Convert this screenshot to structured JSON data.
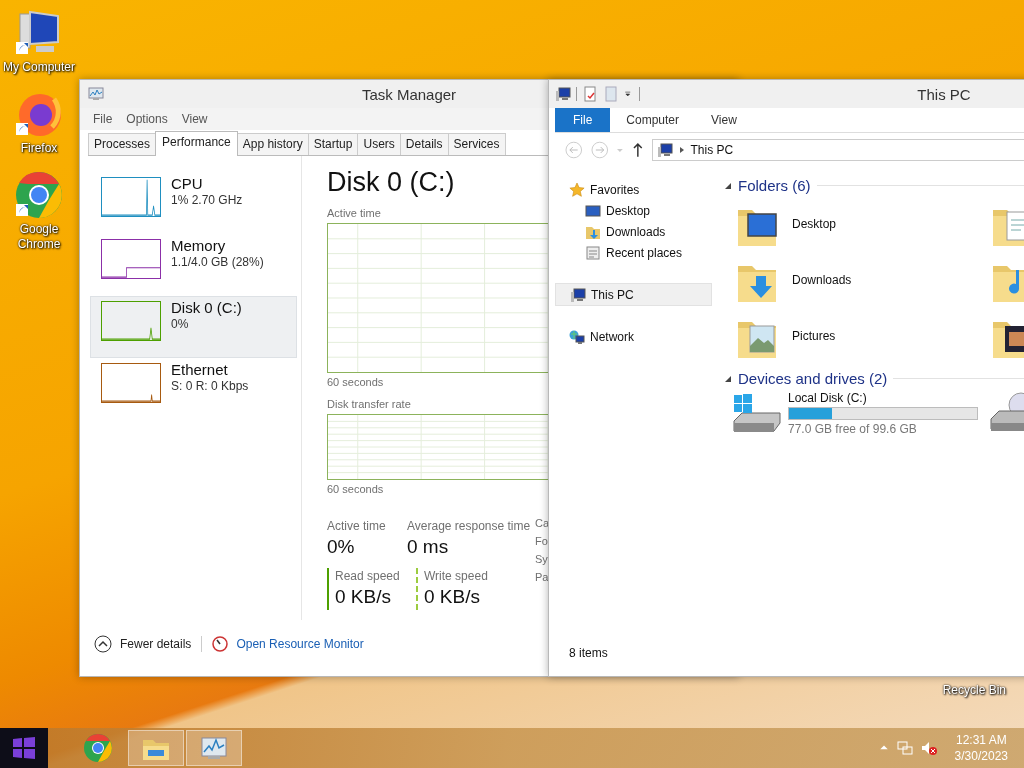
{
  "desktop_icons": [
    {
      "label": "My Computer",
      "kind": "computer"
    },
    {
      "label": "Firefox",
      "kind": "firefox"
    },
    {
      "label": "Google Chrome",
      "kind": "chrome"
    }
  ],
  "recycle_bin": {
    "label": "Recycle Bin"
  },
  "task_manager": {
    "title": "Task Manager",
    "menu": [
      "File",
      "Options",
      "View"
    ],
    "tabs": [
      {
        "label": "Processes",
        "selected": false
      },
      {
        "label": "Performance",
        "selected": true
      },
      {
        "label": "App history",
        "selected": false
      },
      {
        "label": "Startup",
        "selected": false
      },
      {
        "label": "Users",
        "selected": false
      },
      {
        "label": "Details",
        "selected": false
      },
      {
        "label": "Services",
        "selected": false
      }
    ],
    "resources": [
      {
        "name": "CPU",
        "detail": "1% 2.70 GHz",
        "kind": "cpu",
        "color": "#1f8fc0",
        "selected": false
      },
      {
        "name": "Memory",
        "detail": "1.1/4.0 GB (28%)",
        "kind": "memory",
        "color": "#8b2fa8",
        "selected": false
      },
      {
        "name": "Disk 0 (C:)",
        "detail": "0%",
        "kind": "disk",
        "color": "#4da000",
        "selected": true
      },
      {
        "name": "Ethernet",
        "detail": "S: 0 R: 0 Kbps",
        "kind": "ethernet",
        "color": "#a75a10",
        "selected": false
      }
    ],
    "panel": {
      "title": "Disk 0 (C:)",
      "charts": [
        {
          "label": "Active time",
          "footer": "60 seconds",
          "kind": "tall"
        },
        {
          "label": "Disk transfer rate",
          "footer": "60 seconds",
          "kind": "short"
        }
      ],
      "stats": [
        {
          "label": "Active time",
          "value": "0%"
        },
        {
          "label": "Average response time",
          "value": "0 ms"
        }
      ],
      "speeds": [
        {
          "label": "Read speed",
          "value": "0 KB/s",
          "kind": "solid"
        },
        {
          "label": "Write speed",
          "value": "0 KB/s",
          "kind": "dashed"
        }
      ],
      "cut_labels": [
        "Ca",
        "Fo",
        "Sy",
        "Pa"
      ]
    },
    "footer": {
      "fewer_details": "Fewer details",
      "open_resource_monitor": "Open Resource Monitor"
    }
  },
  "explorer": {
    "title": "This PC",
    "ribbon_tabs": [
      {
        "label": "File",
        "selected": true
      },
      {
        "label": "Computer",
        "selected": false
      },
      {
        "label": "View",
        "selected": false
      }
    ],
    "address": "This PC",
    "nav": [
      {
        "label": "Favorites",
        "kind": "star",
        "selected": false,
        "children": [
          {
            "label": "Desktop",
            "kind": "desktop",
            "selected": false
          },
          {
            "label": "Downloads",
            "kind": "downloads",
            "selected": false
          },
          {
            "label": "Recent places",
            "kind": "recent",
            "selected": false
          }
        ]
      },
      {
        "label": "This PC",
        "kind": "pc",
        "selected": true
      },
      {
        "label": "Network",
        "kind": "network",
        "selected": false
      }
    ],
    "folders": {
      "heading": "Folders (6)",
      "items": [
        {
          "name": "Desktop",
          "kind": "desktop"
        },
        {
          "kind": "documents"
        },
        {
          "name": "Downloads",
          "kind": "downloads"
        },
        {
          "kind": "music"
        },
        {
          "name": "Pictures",
          "kind": "pictures"
        },
        {
          "kind": "videos"
        }
      ]
    },
    "devices": {
      "heading": "Devices and drives (2)",
      "drives": [
        {
          "name": "Local Disk (C:)",
          "free": "77.0 GB free of 99.6 GB",
          "level": 0.23,
          "kind": "disk"
        },
        {
          "kind": "dvd"
        }
      ]
    },
    "status": "8 items"
  },
  "taskbar": {
    "apps": [
      {
        "kind": "chrome",
        "active": false
      },
      {
        "kind": "explorer",
        "active": true
      },
      {
        "kind": "taskmanager",
        "active": true
      }
    ],
    "time": "12:31 AM",
    "date": "3/30/2023"
  }
}
